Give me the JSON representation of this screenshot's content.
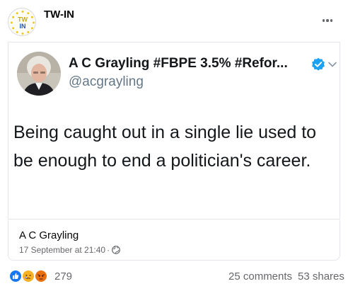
{
  "post": {
    "page_name": "TW-IN",
    "page_avatar_text_top": "TW",
    "page_avatar_text_bottom": "IN",
    "more_icon": "more-horizontal-icon"
  },
  "tweet": {
    "author_name": "A C Grayling #FBPE 3.5% #Refor...",
    "handle": "@acgrayling",
    "verified_icon": "verified-badge-icon",
    "text": "Being caught out in a single lie used to be enough to end a politician's career.",
    "colors": {
      "verified": "#1da1f2",
      "handle": "#657786"
    }
  },
  "link_preview": {
    "title": "A C Grayling",
    "date": "17 September at 21:40",
    "separator": "·",
    "privacy_icon": "globe-icon"
  },
  "footer": {
    "reactions": [
      "like",
      "sad",
      "angry"
    ],
    "reaction_count": "279",
    "comments": "25 comments",
    "shares": "53 shares"
  }
}
